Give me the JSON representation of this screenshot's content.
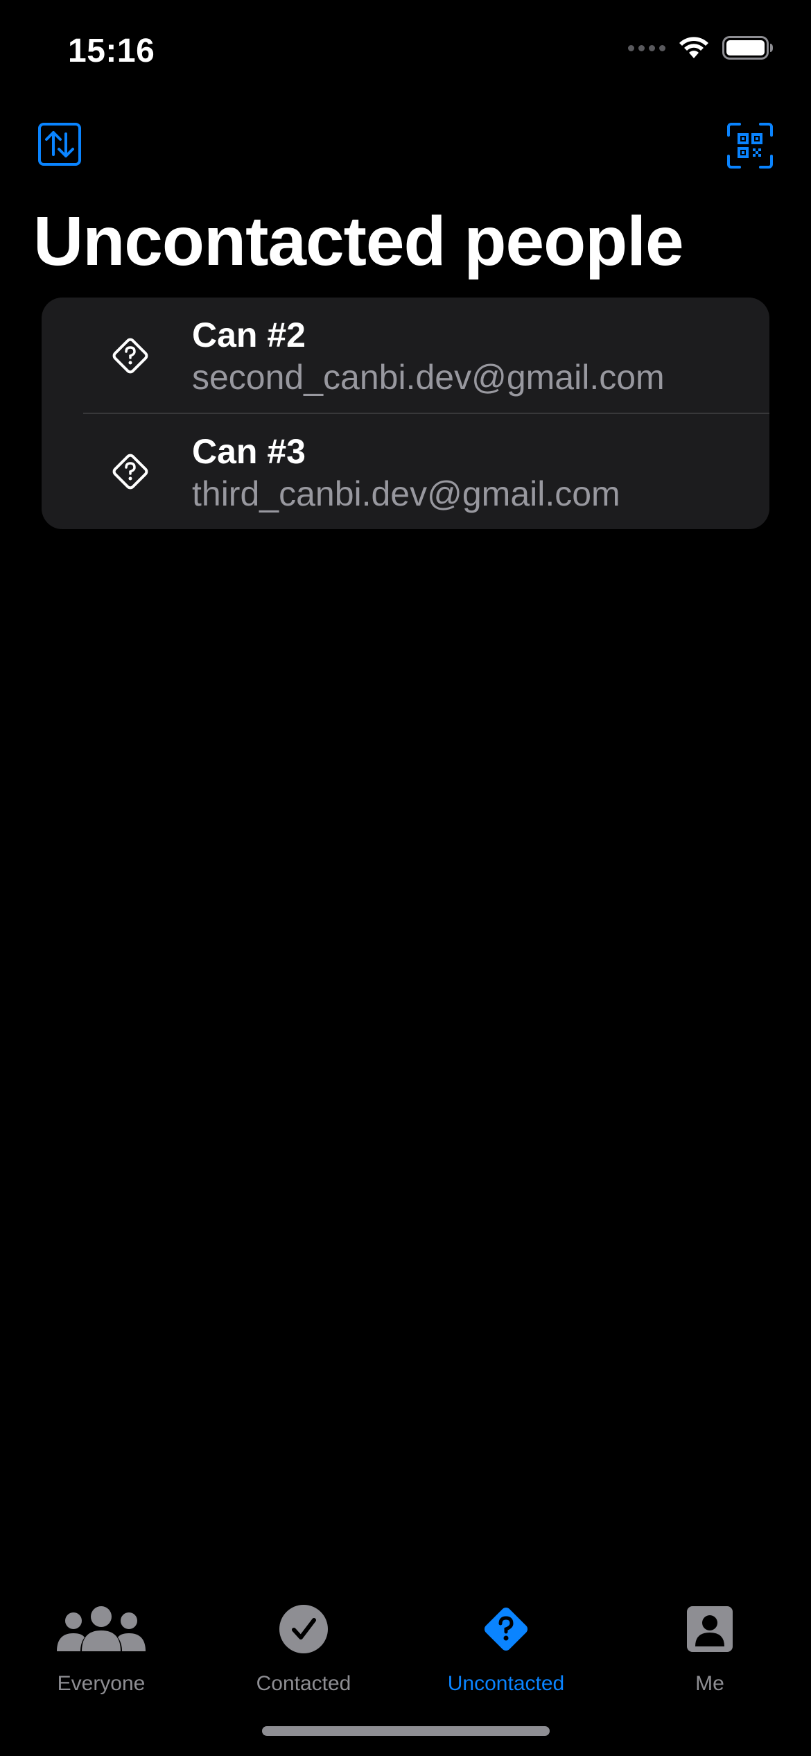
{
  "status_bar": {
    "time": "15:16",
    "icons": [
      "cellular-dots-icon",
      "wifi-icon",
      "battery-icon"
    ]
  },
  "toolbar": {
    "left_icon": "sort-arrows-icon",
    "right_icon": "qr-scan-icon"
  },
  "page_title": "Uncontacted people",
  "people": [
    {
      "name": "Can #2",
      "email": "second_canbi.dev@gmail.com",
      "icon": "question-diamond-icon"
    },
    {
      "name": "Can #3",
      "email": "third_canbi.dev@gmail.com",
      "icon": "question-diamond-icon"
    }
  ],
  "tabs": [
    {
      "label": "Everyone",
      "icon": "people-group-icon",
      "active": false
    },
    {
      "label": "Contacted",
      "icon": "checkmark-circle-icon",
      "active": false
    },
    {
      "label": "Uncontacted",
      "icon": "question-diamond-fill-icon",
      "active": true
    },
    {
      "label": "Me",
      "icon": "person-square-icon",
      "active": false
    }
  ],
  "colors": {
    "accent": "#0a84ff",
    "background": "#000000",
    "card": "#1c1c1e",
    "secondary_text": "#98989f",
    "tab_inactive": "#8e8e93"
  }
}
